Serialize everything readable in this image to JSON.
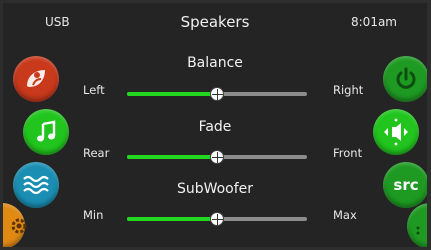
{
  "status": {
    "source": "USB",
    "title": "Speakers",
    "time": "8:01am"
  },
  "controls": [
    {
      "title": "Balance",
      "left_label": "Left",
      "right_label": "Right",
      "value": 0.5
    },
    {
      "title": "Fade",
      "left_label": "Rear",
      "right_label": "Front",
      "value": 0.5
    },
    {
      "title": "SubWoofer",
      "left_label": "Min",
      "right_label": "Max",
      "value": 0.5
    }
  ],
  "left_buttons": [
    {
      "icon": "leaf-person-icon",
      "color": "#c9391c"
    },
    {
      "icon": "music-note-icon",
      "color": "#22c51e"
    },
    {
      "icon": "water-waves-icon",
      "color": "#1a8fb3"
    },
    {
      "icon": "gear-icon",
      "color": "#e08a14"
    }
  ],
  "right_buttons": [
    {
      "icon": "power-icon",
      "color": "#1e9a22"
    },
    {
      "icon": "speaker-balance-icon",
      "color": "#22c51e"
    },
    {
      "icon": "source-icon",
      "label": "src",
      "color": "#1e9a22"
    },
    {
      "icon": "chevron-down-icon",
      "color": "#1e9a22"
    }
  ],
  "accent": "#22d81f"
}
